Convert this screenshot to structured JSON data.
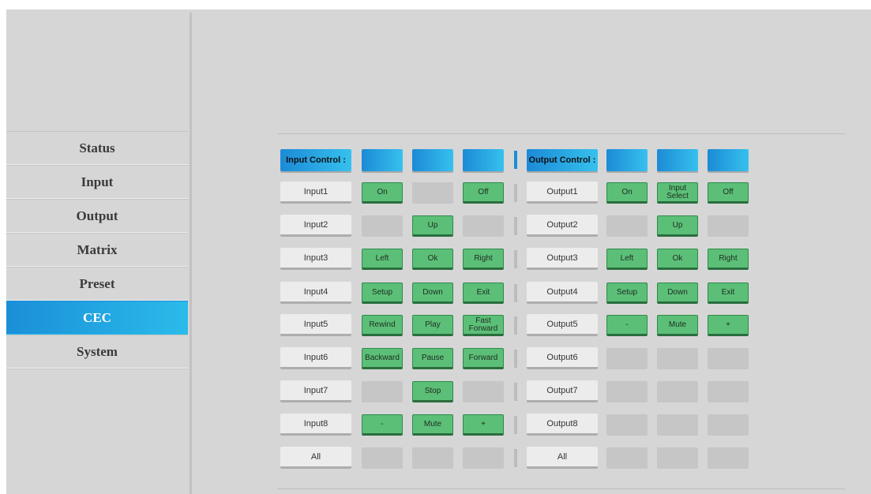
{
  "sidebar": {
    "items": [
      {
        "key": "status",
        "label": "Status",
        "active": false
      },
      {
        "key": "input",
        "label": "Input",
        "active": false
      },
      {
        "key": "output",
        "label": "Output",
        "active": false
      },
      {
        "key": "matrix",
        "label": "Matrix",
        "active": false
      },
      {
        "key": "preset",
        "label": "Preset",
        "active": false
      },
      {
        "key": "cec",
        "label": "CEC",
        "active": true
      },
      {
        "key": "system",
        "label": "System",
        "active": false
      }
    ]
  },
  "input_control": {
    "title": "Input Control :",
    "rows": [
      {
        "label": "Input1",
        "buttons": [
          "On",
          "",
          "Off"
        ]
      },
      {
        "label": "Input2",
        "buttons": [
          "",
          "Up",
          ""
        ]
      },
      {
        "label": "Input3",
        "buttons": [
          "Left",
          "Ok",
          "Right"
        ]
      },
      {
        "label": "Input4",
        "buttons": [
          "Setup",
          "Down",
          "Exit"
        ]
      },
      {
        "label": "Input5",
        "buttons": [
          "Rewind",
          "Play",
          "Fast Forward"
        ]
      },
      {
        "label": "Input6",
        "buttons": [
          "Backward",
          "Pause",
          "Forward"
        ]
      },
      {
        "label": "Input7",
        "buttons": [
          "",
          "Stop",
          ""
        ]
      },
      {
        "label": "Input8",
        "buttons": [
          "-",
          "Mute",
          "+"
        ]
      },
      {
        "label": "All",
        "buttons": [
          "",
          "",
          ""
        ]
      }
    ]
  },
  "output_control": {
    "title": "Output Control :",
    "rows": [
      {
        "label": "Output1",
        "buttons": [
          "On",
          "Input Select",
          "Off"
        ]
      },
      {
        "label": "Output2",
        "buttons": [
          "",
          "Up",
          ""
        ]
      },
      {
        "label": "Output3",
        "buttons": [
          "Left",
          "Ok",
          "Right"
        ]
      },
      {
        "label": "Output4",
        "buttons": [
          "Setup",
          "Down",
          "Exit"
        ]
      },
      {
        "label": "Output5",
        "buttons": [
          "-",
          "Mute",
          "+"
        ]
      },
      {
        "label": "Output6",
        "buttons": [
          "",
          "",
          ""
        ]
      },
      {
        "label": "Output7",
        "buttons": [
          "",
          "",
          ""
        ]
      },
      {
        "label": "Output8",
        "buttons": [
          "",
          "",
          ""
        ]
      },
      {
        "label": "All",
        "buttons": [
          "",
          "",
          ""
        ]
      }
    ]
  },
  "colors": {
    "accent": "#1a8fd8",
    "button_green": "#5cbf78",
    "panel_bg": "#d6d6d6"
  }
}
